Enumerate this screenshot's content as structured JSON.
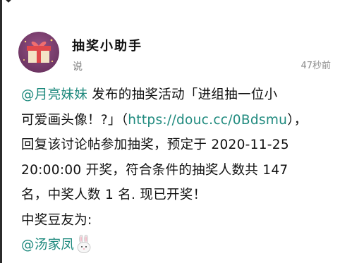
{
  "post": {
    "author": "抽奖小助手",
    "subtext": "说",
    "time": "47秒前",
    "mention_prefix": "@",
    "host_name": "月亮妹妹",
    "line1_text": " 发布的抽奖活动「进组抽一位小",
    "line2_text": "可爱画头像！?」（",
    "url": "https://douc.cc/0Bdsmu",
    "line2_tail": "），",
    "line3_text": "回复该讨论帖参加抽奖，预定于 2020-11-25",
    "line4_text": "20:00:00 开奖，符合条件的抽奖人数共 147",
    "line5_text": "名，中奖人数 1 名. 现已开奖！",
    "line6_text": "中奖豆友为:",
    "winner_name": "汤家凤"
  },
  "icons": {
    "avatar": "gift-box-avatar-icon",
    "winner_suffix": "rabbit-emoji-icon",
    "top": "chevron-down-icon"
  },
  "colors": {
    "link": "#1f8a7e",
    "avatar_bg": "#7a3b6e",
    "gift_red": "#e0484b"
  }
}
